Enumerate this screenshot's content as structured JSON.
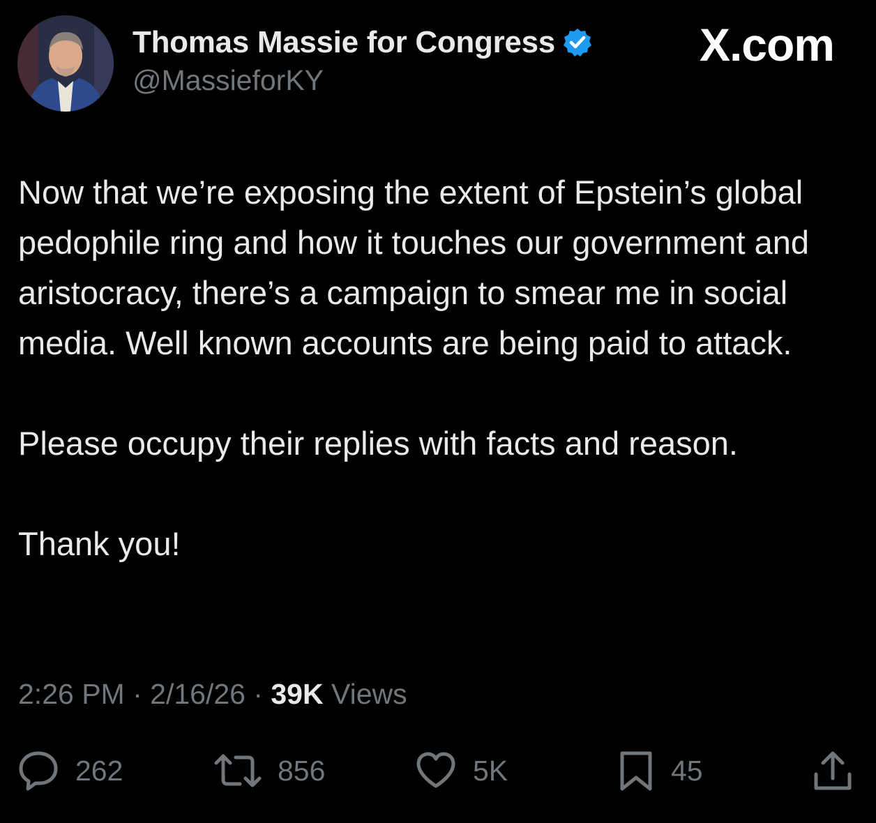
{
  "author": {
    "display_name": "Thomas Massie for Congress",
    "handle": "@MassieforKY",
    "verified_color": "#1d9bf0"
  },
  "brand": "X.com",
  "tweet": {
    "paragraphs": [
      "Now that we’re exposing the extent of Epstein’s global pedophile ring and how it touches our government and aristocracy, there’s a campaign to smear me in social media. Well known accounts are being paid to attack.",
      "Please occupy their replies with facts and reason.",
      "Thank you!"
    ]
  },
  "meta": {
    "time": "2:26 PM",
    "separator": " · ",
    "date": "2/16/26",
    "views_count": "39K",
    "views_label": "Views"
  },
  "actions": {
    "reply_count": "262",
    "retweet_count": "856",
    "like_count": "5K",
    "bookmark_count": "45"
  },
  "icons": {
    "verified": "verified-badge-icon",
    "reply": "reply-bubble-icon",
    "retweet": "retweet-arrows-icon",
    "like": "heart-icon",
    "bookmark": "bookmark-icon",
    "share": "share-upload-icon"
  },
  "colors": {
    "background": "#000000",
    "text_primary": "#e7e9ea",
    "text_secondary": "#71767b",
    "accent": "#1d9bf0"
  }
}
